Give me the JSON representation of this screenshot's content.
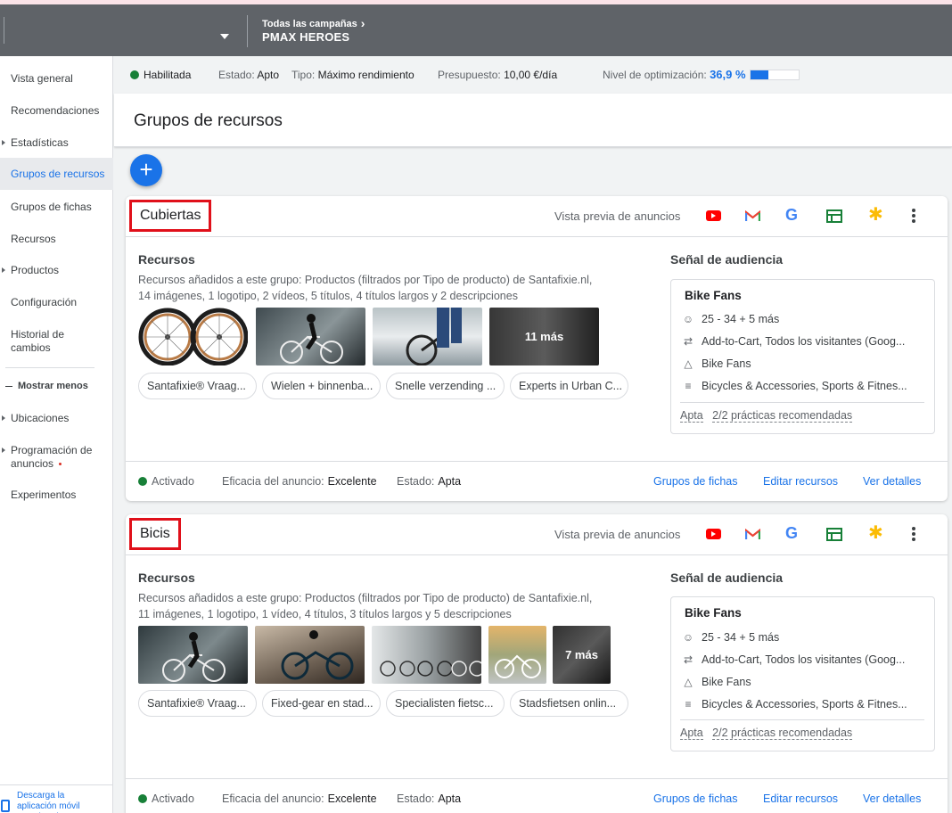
{
  "header": {
    "breadcrumb": "Todas las campañas",
    "campaign_name": "PMAX HEROES"
  },
  "sidebar": {
    "items": [
      {
        "label": "Vista general"
      },
      {
        "label": "Recomendaciones"
      },
      {
        "label": "Estadísticas"
      },
      {
        "label": "Grupos de recursos"
      },
      {
        "label": "Grupos de fichas"
      },
      {
        "label": "Recursos"
      },
      {
        "label": "Productos"
      },
      {
        "label": "Configuración"
      },
      {
        "label": "Historial de cambios"
      },
      {
        "label": "Mostrar menos"
      },
      {
        "label": "Ubicaciones"
      },
      {
        "label": "Programación de anuncios"
      },
      {
        "label": "Experimentos"
      }
    ],
    "download": "Descarga la aplicación móvil Google Ads"
  },
  "status": {
    "enabled": "Habilitada",
    "estado_label": "Estado:",
    "estado_value": "Apto",
    "tipo_label": "Tipo:",
    "tipo_value": "Máximo rendimiento",
    "budget_label": "Presupuesto:",
    "budget_value": "10,00 €/día",
    "opt_label": "Nivel de optimización:",
    "opt_value": "36,9 %",
    "opt_fraction": 0.369,
    "colors": {
      "accent": "#1a73e8",
      "enabled": "#188038",
      "highlight": "#e0101a"
    }
  },
  "page_title": "Grupos de recursos",
  "common": {
    "preview_label": "Vista previa de anuncios",
    "recursos_title": "Recursos",
    "audience_title": "Señal de audiencia",
    "audience_name": "Bike Fans",
    "audience_age": "25 - 34 + 5 más",
    "audience_behaviour": "Add-to-Cart, Todos los visitantes (Goog...",
    "audience_segment": "Bike Fans",
    "audience_interests": "Bicycles & Accessories, Sports & Fitnes...",
    "audience_apt": "Apta",
    "audience_practices": "2/2 prácticas recomendadas",
    "activated": "Activado",
    "efficacy_label": "Eficacia del anuncio:",
    "efficacy_value": "Excelente",
    "state_label": "Estado:",
    "state_value": "Apta",
    "link_listing": "Grupos de fichas",
    "link_edit": "Editar recursos",
    "link_details": "Ver detalles",
    "icons": [
      "youtube-icon",
      "gmail-icon",
      "google-icon",
      "sheets-icon",
      "discover-icon",
      "more-vert-icon"
    ]
  },
  "groups": [
    {
      "name": "Cubiertas",
      "desc1": "Recursos añadidos a este grupo: Productos (filtrados por Tipo de producto) de Santafixie.nl,",
      "desc2": "14 imágenes, 1 logotipo, 2 vídeos, 5 títulos, 4 títulos largos y 2 descripciones",
      "more_overlay": "11 más",
      "chips": [
        "Santafixie® Vraag...",
        "Wielen + binnenba...",
        "Snelle verzending ...",
        "Experts in Urban C..."
      ]
    },
    {
      "name": "Bicis",
      "desc1": "Recursos añadidos a este grupo: Productos (filtrados por Tipo de producto) de Santafixie.nl,",
      "desc2": "11 imágenes, 1 logotipo, 1 vídeo, 4 títulos, 3 títulos largos y 5 descripciones",
      "more_overlay": "7 más",
      "chips": [
        "Santafixie® Vraag...",
        "Fixed-gear en stad...",
        "Specialisten fietsc...",
        "Stadsfietsen onlin..."
      ]
    }
  ]
}
